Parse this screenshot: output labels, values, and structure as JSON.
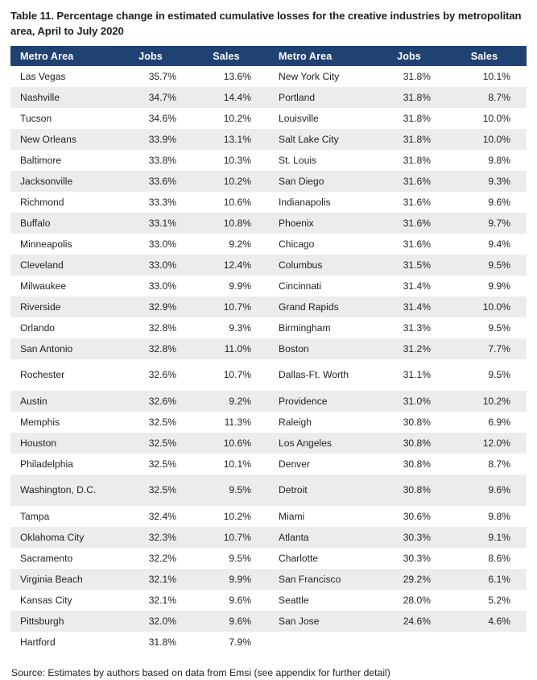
{
  "title": "Table 11. Percentage change in estimated cumulative losses for the creative industries by metropolitan area, April to July 2020",
  "source": "Source: Estimates by authors based on data from Emsi (see appendix for further detail)",
  "colors": {
    "header_background": "#1f4273",
    "header_text": "#ffffff",
    "row_alt_background": "#ececec",
    "row_background": "#ffffff",
    "body_text": "#231f20"
  },
  "headers": {
    "metro_left": "Metro Area",
    "jobs_left": "Jobs",
    "sales_left": "Sales",
    "metro_right": "Metro Area",
    "jobs_right": "Jobs",
    "sales_right": "Sales"
  },
  "chart_data": {
    "type": "table",
    "title": "Table 11. Percentage change in estimated cumulative losses for the creative industries by metropolitan area, April to July 2020",
    "columns": [
      "Metro Area",
      "Jobs",
      "Sales"
    ],
    "left_column": [
      {
        "metro": "Las Vegas",
        "jobs": "35.7%",
        "sales": "13.6%"
      },
      {
        "metro": "Nashville",
        "jobs": "34.7%",
        "sales": "14.4%"
      },
      {
        "metro": "Tucson",
        "jobs": "34.6%",
        "sales": "10.2%"
      },
      {
        "metro": "New Orleans",
        "jobs": "33.9%",
        "sales": "13.1%"
      },
      {
        "metro": "Baltimore",
        "jobs": "33.8%",
        "sales": "10.3%"
      },
      {
        "metro": "Jacksonville",
        "jobs": "33.6%",
        "sales": "10.2%"
      },
      {
        "metro": "Richmond",
        "jobs": "33.3%",
        "sales": "10.6%"
      },
      {
        "metro": "Buffalo",
        "jobs": "33.1%",
        "sales": "10.8%"
      },
      {
        "metro": "Minneapolis",
        "jobs": "33.0%",
        "sales": "9.2%"
      },
      {
        "metro": "Cleveland",
        "jobs": "33.0%",
        "sales": "12.4%"
      },
      {
        "metro": "Milwaukee",
        "jobs": "33.0%",
        "sales": "9.9%"
      },
      {
        "metro": "Riverside",
        "jobs": "32.9%",
        "sales": "10.7%"
      },
      {
        "metro": "Orlando",
        "jobs": "32.8%",
        "sales": "9.3%"
      },
      {
        "metro": "San Antonio",
        "jobs": "32.8%",
        "sales": "11.0%"
      },
      {
        "metro": "Rochester",
        "jobs": "32.6%",
        "sales": "10.7%"
      },
      {
        "metro": "Austin",
        "jobs": "32.6%",
        "sales": "9.2%"
      },
      {
        "metro": "Memphis",
        "jobs": "32.5%",
        "sales": "11.3%"
      },
      {
        "metro": "Houston",
        "jobs": "32.5%",
        "sales": "10.6%"
      },
      {
        "metro": "Philadelphia",
        "jobs": "32.5%",
        "sales": "10.1%"
      },
      {
        "metro": "Washington, D.C.",
        "jobs": "32.5%",
        "sales": "9.5%"
      },
      {
        "metro": "Tampa",
        "jobs": "32.4%",
        "sales": "10.2%"
      },
      {
        "metro": "Oklahoma City",
        "jobs": "32.3%",
        "sales": "10.7%"
      },
      {
        "metro": "Sacramento",
        "jobs": "32.2%",
        "sales": "9.5%"
      },
      {
        "metro": "Virginia Beach",
        "jobs": "32.1%",
        "sales": "9.9%"
      },
      {
        "metro": "Kansas City",
        "jobs": "32.1%",
        "sales": "9.6%"
      },
      {
        "metro": "Pittsburgh",
        "jobs": "32.0%",
        "sales": "9.6%"
      },
      {
        "metro": "Hartford",
        "jobs": "31.8%",
        "sales": "7.9%"
      }
    ],
    "right_column": [
      {
        "metro": "New York City",
        "jobs": "31.8%",
        "sales": "10.1%"
      },
      {
        "metro": "Portland",
        "jobs": "31.8%",
        "sales": "8.7%"
      },
      {
        "metro": "Louisville",
        "jobs": "31.8%",
        "sales": "10.0%"
      },
      {
        "metro": "Salt Lake City",
        "jobs": "31.8%",
        "sales": "10.0%"
      },
      {
        "metro": "St. Louis",
        "jobs": "31.8%",
        "sales": "9.8%"
      },
      {
        "metro": "San Diego",
        "jobs": "31.6%",
        "sales": "9.3%"
      },
      {
        "metro": "Indianapolis",
        "jobs": "31.6%",
        "sales": "9.6%"
      },
      {
        "metro": "Phoenix",
        "jobs": "31.6%",
        "sales": "9.7%"
      },
      {
        "metro": "Chicago",
        "jobs": "31.6%",
        "sales": "9.4%"
      },
      {
        "metro": "Columbus",
        "jobs": "31.5%",
        "sales": "9.5%"
      },
      {
        "metro": "Cincinnati",
        "jobs": "31.4%",
        "sales": "9.9%"
      },
      {
        "metro": "Grand Rapids",
        "jobs": "31.4%",
        "sales": "10.0%"
      },
      {
        "metro": "Birmingham",
        "jobs": "31.3%",
        "sales": "9.5%"
      },
      {
        "metro": "Boston",
        "jobs": "31.2%",
        "sales": "7.7%"
      },
      {
        "metro": "Dallas-Ft. Worth",
        "jobs": "31.1%",
        "sales": "9.5%"
      },
      {
        "metro": "Providence",
        "jobs": "31.0%",
        "sales": "10.2%"
      },
      {
        "metro": "Raleigh",
        "jobs": "30.8%",
        "sales": "6.9%"
      },
      {
        "metro": "Los Angeles",
        "jobs": "30.8%",
        "sales": "12.0%"
      },
      {
        "metro": "Denver",
        "jobs": "30.8%",
        "sales": "8.7%"
      },
      {
        "metro": "Detroit",
        "jobs": "30.8%",
        "sales": "9.6%"
      },
      {
        "metro": "Miami",
        "jobs": "30.6%",
        "sales": "9.8%"
      },
      {
        "metro": "Atlanta",
        "jobs": "30.3%",
        "sales": "9.1%"
      },
      {
        "metro": "Charlotte",
        "jobs": "30.3%",
        "sales": "8.6%"
      },
      {
        "metro": "San Francisco",
        "jobs": "29.2%",
        "sales": "6.1%"
      },
      {
        "metro": "Seattle",
        "jobs": "28.0%",
        "sales": "5.2%"
      },
      {
        "metro": "San Jose",
        "jobs": "24.6%",
        "sales": "4.6%"
      },
      {
        "metro": "",
        "jobs": "",
        "sales": ""
      }
    ],
    "tall_row_indices": [
      14,
      19
    ]
  }
}
